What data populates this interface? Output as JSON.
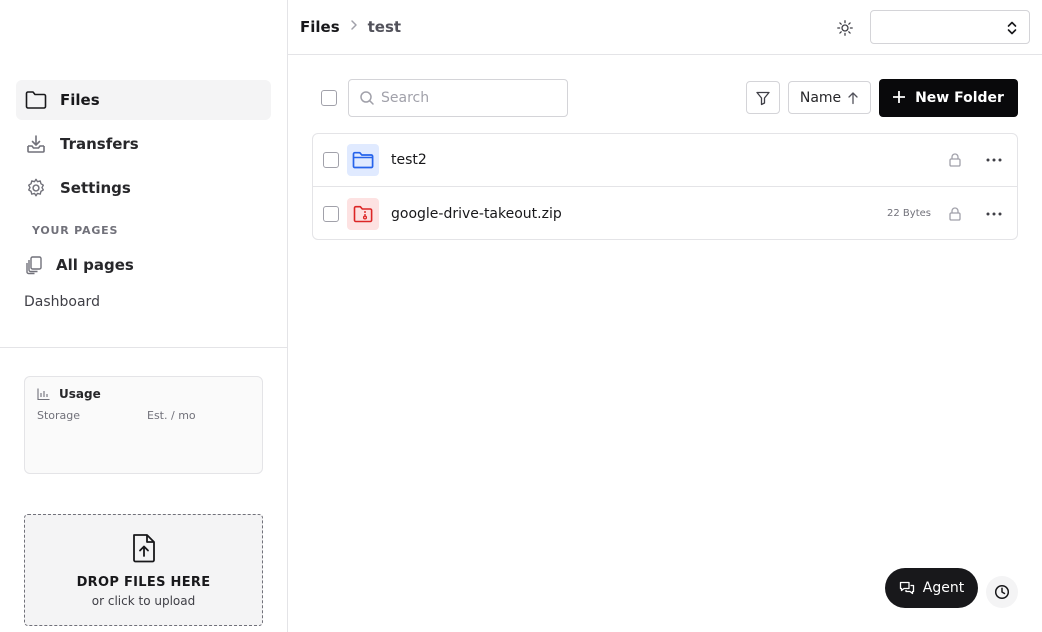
{
  "sidebar": {
    "nav": [
      {
        "label": "Files",
        "icon": "folder-icon",
        "active": true
      },
      {
        "label": "Transfers",
        "icon": "download-tray-icon"
      },
      {
        "label": "Settings",
        "icon": "gear-icon"
      }
    ],
    "section_label": "YOUR PAGES",
    "all_pages": "All pages",
    "dashboard": "Dashboard",
    "usage": {
      "title": "Usage",
      "storage_label": "Storage",
      "est_label": "Est. / mo"
    },
    "dropzone": {
      "title": "DROP FILES HERE",
      "subtitle": "or click to upload"
    }
  },
  "header": {
    "breadcrumb": [
      "Files",
      "test"
    ],
    "workspace_select": ""
  },
  "toolbar": {
    "search_placeholder": "Search",
    "sort_label": "Name",
    "new_folder_label": "New Folder"
  },
  "files": [
    {
      "name": "test2",
      "type": "folder",
      "size": ""
    },
    {
      "name": "google-drive-takeout.zip",
      "type": "zip",
      "size": "22 Bytes"
    }
  ],
  "floating": {
    "agent_label": "Agent"
  },
  "colors": {
    "accent": "#09090b",
    "folder_icon": "#2563eb",
    "zip_icon": "#dc2626"
  }
}
